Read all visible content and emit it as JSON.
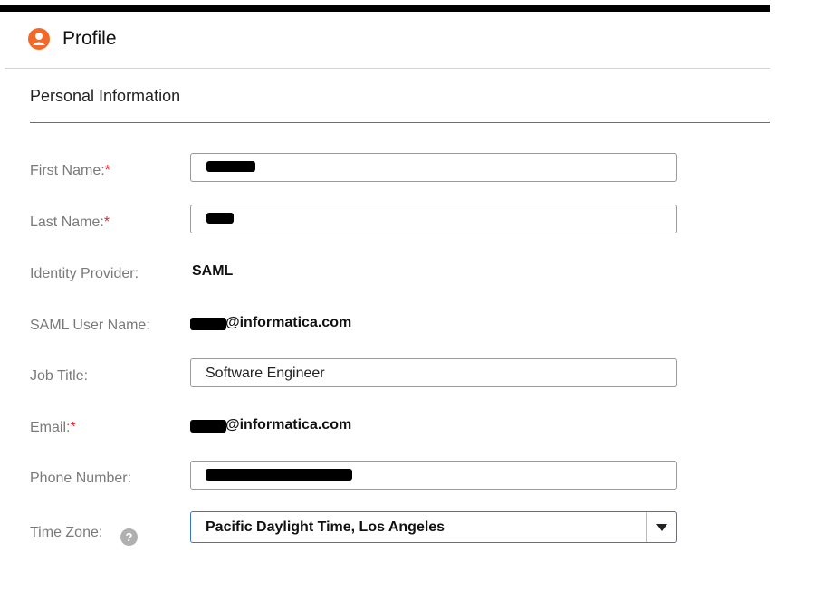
{
  "header": {
    "title": "Profile",
    "icon": "user-icon",
    "icon_color": "#f26a2a"
  },
  "section": {
    "title": "Personal Information"
  },
  "fields": {
    "first_name": {
      "label": "First Name:",
      "required_mark": "*",
      "value": ""
    },
    "last_name": {
      "label": "Last Name:",
      "required_mark": "*",
      "value": ""
    },
    "identity_provider": {
      "label": "Identity Provider:",
      "value": "SAML"
    },
    "saml_user_name": {
      "label": "SAML User Name:",
      "value_suffix": "@informatica.com"
    },
    "job_title": {
      "label": "Job Title:",
      "value": "Software Engineer"
    },
    "email": {
      "label": "Email:",
      "required_mark": "*",
      "value_suffix": "@informatica.com"
    },
    "phone_number": {
      "label": "Phone Number:",
      "value": ""
    },
    "time_zone": {
      "label": "Time Zone:",
      "help": "?",
      "value": "Pacific Daylight Time, Los Angeles"
    }
  },
  "colors": {
    "accent_border": "#3b77c9",
    "required": "#e0262e"
  }
}
